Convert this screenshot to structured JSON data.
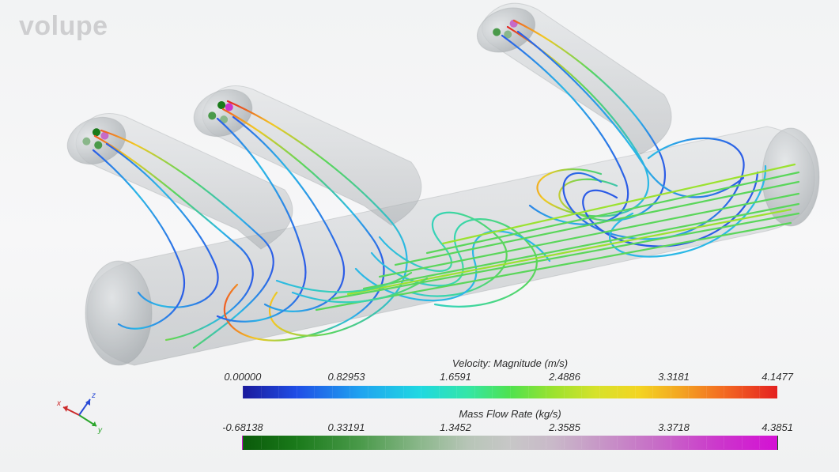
{
  "watermark": "volupe",
  "axes": {
    "x": "x",
    "y": "y",
    "z": "z"
  },
  "legend_velocity": {
    "title": "Velocity: Magnitude (m/s)",
    "ticks": [
      "0.00000",
      "0.82953",
      "1.6591",
      "2.4886",
      "3.3181",
      "4.1477"
    ]
  },
  "legend_massflow": {
    "title": "Mass Flow Rate (kg/s)",
    "ticks": [
      "-0.68138",
      "0.33191",
      "1.3452",
      "2.3585",
      "3.3718",
      "4.3851"
    ]
  },
  "chart_data": {
    "type": "scientific-visualization",
    "description": "CFD streamline plot inside a branching pipe manifold (one main cylinder with three angled branch outlets). Streamlines colored by velocity magnitude; branch cross-sections colored by mass flow rate.",
    "colorbars": [
      {
        "name": "Velocity: Magnitude",
        "unit": "m/s",
        "min": 0.0,
        "max": 4.1477,
        "ticks": [
          0.0,
          0.82953,
          1.6591,
          2.4886,
          3.3181,
          4.1477
        ],
        "colormap": "rainbow (blue→cyan→green→yellow→orange→red)"
      },
      {
        "name": "Mass Flow Rate",
        "unit": "kg/s",
        "min": -0.68138,
        "max": 4.3851,
        "ticks": [
          -0.68138,
          0.33191,
          1.3452,
          2.3585,
          3.3718,
          4.3851
        ],
        "colormap": "diverging green→grey→magenta"
      }
    ],
    "orientation_axes": [
      "x",
      "y",
      "z"
    ]
  }
}
